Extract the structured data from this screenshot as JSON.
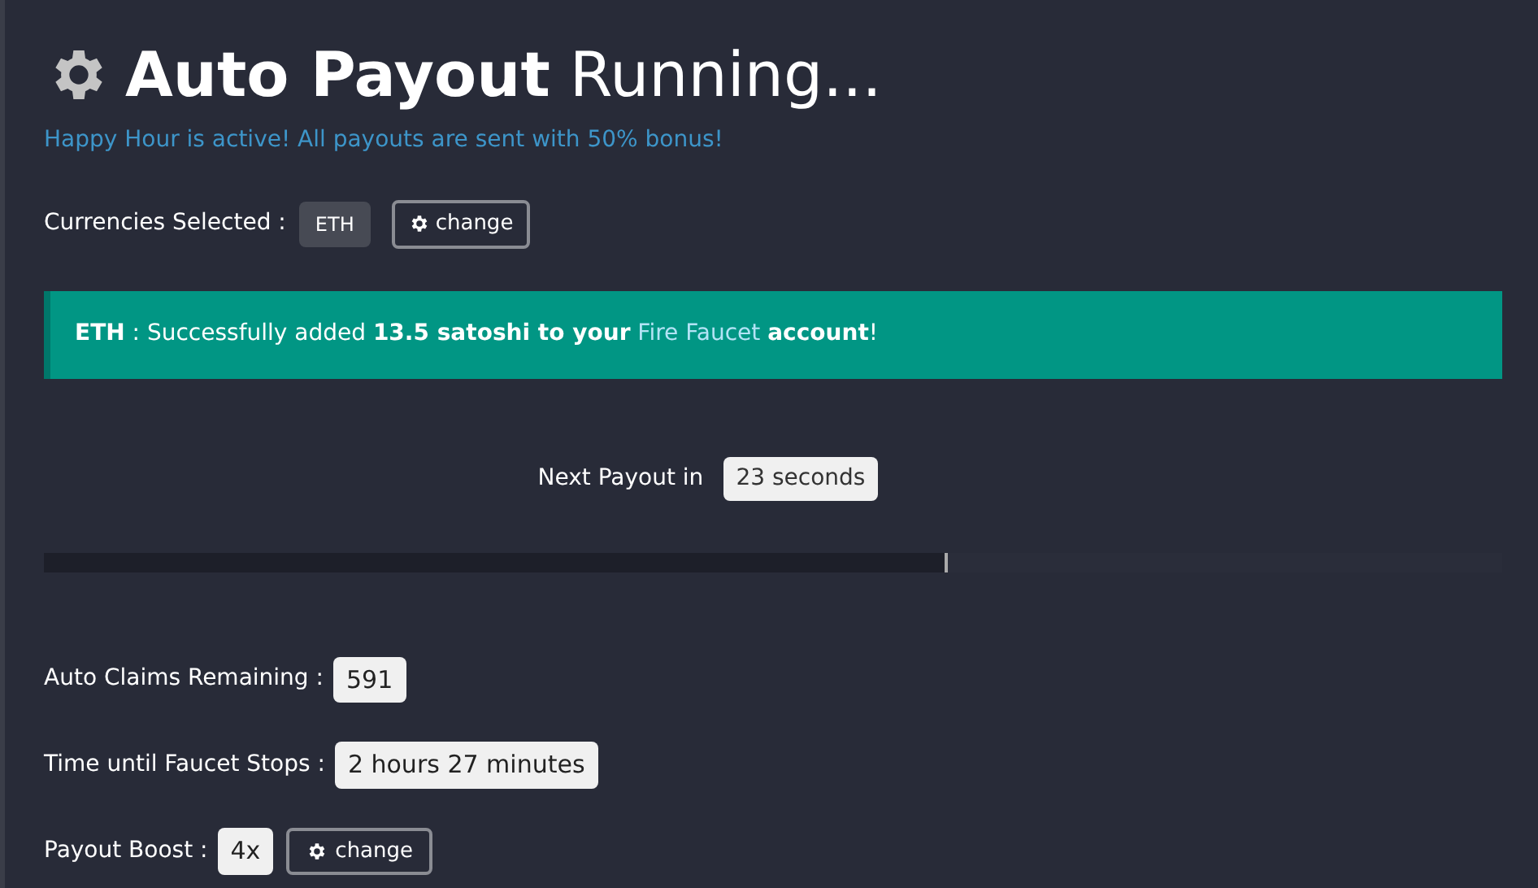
{
  "title": {
    "bold": "Auto Payout",
    "rest": "Running..."
  },
  "happy_hour": "Happy Hour is active! All payouts are sent with 50% bonus!",
  "currencies": {
    "label": "Currencies Selected :",
    "value": "ETH",
    "button": "change"
  },
  "alert": {
    "before": "**ETH** : Successfully added **13.5 satoshi to your** ",
    "link": "Fire Faucet",
    "after": " **account**!"
  },
  "next_payout": {
    "label": "Next Payout in",
    "number": "23",
    "unit": "seconds"
  },
  "progress": {
    "level": 0.62
  },
  "stats": [
    {
      "label": "Auto Claims Remaining :",
      "value": "591"
    },
    {
      "label": "Time until Faucet Stops :",
      "value": "2 hours 27 minutes"
    },
    {
      "label": "Payout Boost :",
      "value": "4x",
      "button": "change"
    }
  ]
}
